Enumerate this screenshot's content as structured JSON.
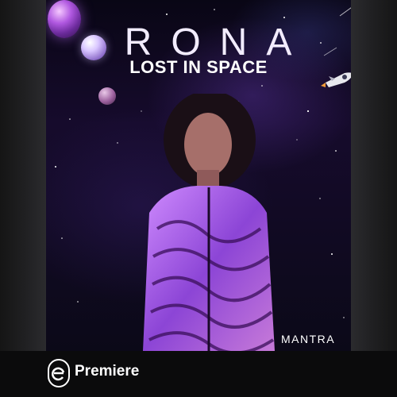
{
  "cover": {
    "artist": "RONA",
    "title": "LOST IN SPACE",
    "label": "MANTRA"
  },
  "footer": {
    "brand": "Premiere",
    "badge_icon": "premiere-e-icon"
  },
  "colors": {
    "background": "#0a0a0d",
    "accent_purple": "#8a46d8",
    "text": "#ffffff"
  }
}
